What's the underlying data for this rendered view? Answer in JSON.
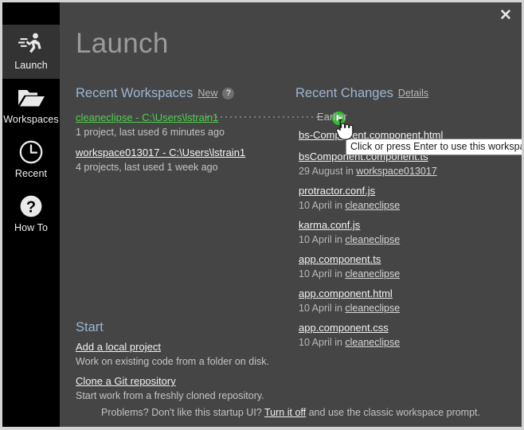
{
  "window": {
    "title": "Launch",
    "close_label": "✕",
    "colors": {
      "background": "#454545",
      "sidebar": "#000000",
      "sidebar_active": "#333333",
      "heading": "#9cb6d2",
      "link": "#f2f2f2",
      "hover_link": "#4fd24f",
      "accent_green": "#2fc12f",
      "muted_text": "#c0c0c0",
      "tooltip_bg": "#ffffff",
      "window_border": "#d4d4d4"
    }
  },
  "sidebar": {
    "items": [
      {
        "label": "Launch",
        "icon": "runner-icon",
        "active": true
      },
      {
        "label": "Workspaces",
        "icon": "folder-icon",
        "active": false
      },
      {
        "label": "Recent",
        "icon": "clock-icon",
        "active": false
      },
      {
        "label": "How To",
        "icon": "question-icon",
        "active": false
      }
    ]
  },
  "recent_workspaces": {
    "heading": "Recent Workspaces",
    "new_link": "New",
    "help_icon": "?",
    "items": [
      {
        "name": "cleaneclipse - C:\\Users\\lstrain1",
        "meta": "1 project, last used 6 minutes ago",
        "hovered": true
      },
      {
        "name": "workspace013017 - C:\\Users\\lstrain1",
        "meta": "4 projects, last used 1 week ago",
        "hovered": false
      }
    ]
  },
  "recent_changes": {
    "heading": "Recent Changes",
    "details_link": "Details",
    "group_label": "Earlier",
    "run_button_label": "▶",
    "items": [
      {
        "file": "bs-Component.component.html",
        "meta_date": "",
        "meta_in": "",
        "workspace": ""
      },
      {
        "file": "bsComponent.component.ts",
        "meta_date": "29 August",
        "meta_in": "in",
        "workspace": "workspace013017"
      },
      {
        "file": "protractor.conf.js",
        "meta_date": "10 April",
        "meta_in": "in",
        "workspace": "cleaneclipse"
      },
      {
        "file": "karma.conf.js",
        "meta_date": "10 April",
        "meta_in": "in",
        "workspace": "cleaneclipse"
      },
      {
        "file": "app.component.ts",
        "meta_date": "10 April",
        "meta_in": "in",
        "workspace": "cleaneclipse"
      },
      {
        "file": "app.component.html",
        "meta_date": "10 April",
        "meta_in": "in",
        "workspace": "cleaneclipse"
      },
      {
        "file": "app.component.css",
        "meta_date": "10 April",
        "meta_in": "in",
        "workspace": "cleaneclipse"
      }
    ]
  },
  "tooltip": {
    "text": "Click or press Enter to use this workspace"
  },
  "start": {
    "heading": "Start",
    "items": [
      {
        "link": "Add a local project",
        "description": "Work on existing code from a folder on disk."
      },
      {
        "link": "Clone a Git repository",
        "description": "Start work from a freshly cloned repository."
      }
    ]
  },
  "footer": {
    "prefix": "Problems? Don't like this startup UI?",
    "link": "Turn it off",
    "suffix": "and use the classic workspace prompt."
  }
}
